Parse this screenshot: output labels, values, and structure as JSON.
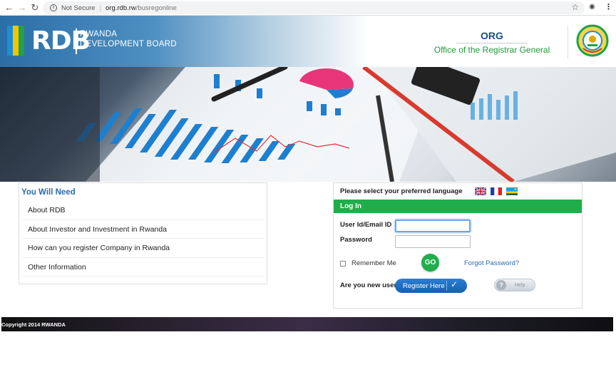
{
  "browser": {
    "security_label": "Not Secure",
    "url_host": "org.rdb.rw",
    "url_path": "/busregonline"
  },
  "header": {
    "logo_text": "RDB",
    "logo_subtitle_line1": "RWANDA",
    "logo_subtitle_line2": "DEVELOPMENT BOARD",
    "org_title": "ORG",
    "org_subtitle": "Office of the Registrar General",
    "flag_colors": [
      "#1a8ed6",
      "#f5c400",
      "#1fa24a"
    ]
  },
  "need": {
    "title": "You Will Need",
    "items": [
      "About RDB",
      "About Investor and Investment in Rwanda",
      "How can you register Company in Rwanda",
      "Other Information"
    ]
  },
  "login": {
    "language_prompt": "Please select your preferred language",
    "languages": [
      "english-flag-icon",
      "french-flag-icon",
      "rwanda-flag-icon"
    ],
    "section_title": "Log In",
    "userid_label": "User Id/Email ID",
    "password_label": "Password",
    "userid_value": "",
    "password_value": "",
    "remember_label": "Remember Me",
    "go_label": "GO",
    "forgot_label": "Forgot Password?",
    "new_user_label": "Are you new user?",
    "register_label": "Register Here",
    "help_label": "Help",
    "accent_color": "#1fae4b"
  },
  "footer": {
    "copyright": "Copyright 2014 RWANDA"
  }
}
